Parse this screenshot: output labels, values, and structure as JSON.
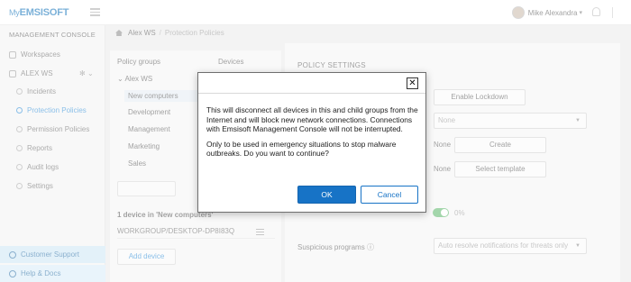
{
  "app": {
    "logo_my": "My",
    "logo_brand": "EMSISOFT"
  },
  "header": {
    "user_name": "Mike Alexandra"
  },
  "sidebar": {
    "heading": "MANAGEMENT CONSOLE",
    "workspaces": "Workspaces",
    "workspace_name": "ALEX WS",
    "items": [
      "Incidents",
      "Protection Policies",
      "Permission Policies",
      "Reports",
      "Audit logs",
      "Settings"
    ],
    "customer_support": "Customer Support",
    "help_docs": "Help & Docs"
  },
  "breadcrumb": {
    "workspace": "Alex WS",
    "separator": "/",
    "current": "Protection Policies"
  },
  "groups": {
    "col_groups": "Policy groups",
    "col_devices": "Devices",
    "root": "Alex WS",
    "items": [
      "New computers",
      "Development",
      "Management",
      "Marketing",
      "Sales"
    ],
    "device_count": "1 device in 'New computers'",
    "device_name": "WORKGROUP/DESKTOP-DP8I83Q",
    "add_device": "Add device"
  },
  "policy": {
    "title": "POLICY SETTINGS",
    "enable_lockdown": "Enable Lockdown",
    "select_none": "None",
    "none_label_1": "None",
    "create": "Create",
    "none_label_2": "None",
    "select_template": "Select template",
    "toggle_value": "0%",
    "suspicious_label": "Suspicious programs",
    "suspicious_value": "Auto resolve notifications for threats only"
  },
  "modal": {
    "close_glyph": "✕",
    "paragraph1": "This will disconnect all devices in this and child groups from the Internet and will block new network connections. Connections with Emsisoft Management Console will not be interrupted.",
    "paragraph2": "Only to be used in emergency situations to stop malware outbreaks. Do you want to continue?",
    "ok_label": "OK",
    "cancel_label": "Cancel"
  }
}
